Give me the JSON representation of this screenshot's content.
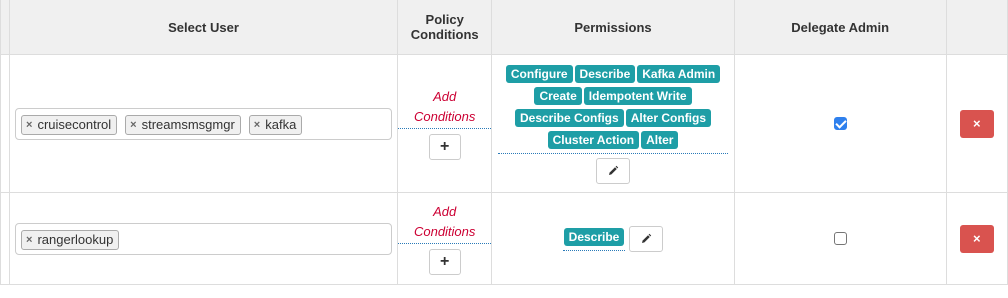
{
  "headers": {
    "select_user": "Select User",
    "policy_conditions": "Policy Conditions",
    "permissions": "Permissions",
    "delegate_admin": "Delegate Admin"
  },
  "rows": [
    {
      "users": [
        "cruisecontrol",
        "streamsmsgmgr",
        "kafka"
      ],
      "add_conditions": "Add Conditions",
      "permissions": [
        "Configure",
        "Describe",
        "Kafka Admin",
        "Create",
        "Idempotent Write",
        "Describe Configs",
        "Alter Configs",
        "Cluster Action",
        "Alter"
      ],
      "delegate_admin": true
    },
    {
      "users": [
        "rangerlookup"
      ],
      "add_conditions": "Add Conditions",
      "permissions": [
        "Describe"
      ],
      "delegate_admin": false
    }
  ],
  "icons": {
    "remove_chip": "×",
    "add": "+",
    "edit": "pencil-icon",
    "delete": "×"
  },
  "colors": {
    "badge": "#1e9ea6",
    "delete": "#d9534f",
    "condition_link": "#cc0033",
    "checkbox": "#2f80ed"
  }
}
